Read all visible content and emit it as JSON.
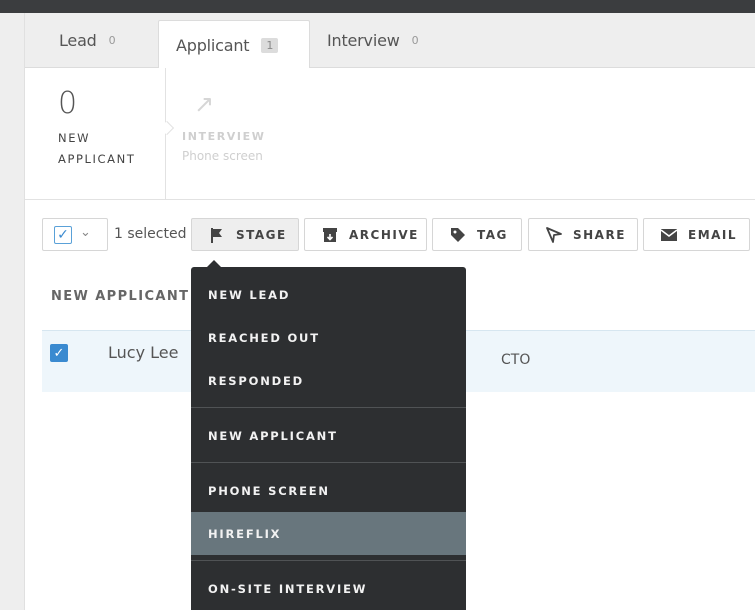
{
  "tabs": [
    {
      "label": "Lead",
      "count": "0"
    },
    {
      "label": "Applicant",
      "count": "1"
    },
    {
      "label": "Interview",
      "count": "0"
    }
  ],
  "stage": {
    "current_count": "0",
    "current_name": "NEW APPLICANT",
    "next_title": "INTERVIEW",
    "next_sub": "Phone screen"
  },
  "toolbar": {
    "selected_text": "1 selected",
    "buttons": [
      "STAGE",
      "ARCHIVE",
      "TAG",
      "SHARE",
      "EMAIL"
    ]
  },
  "list": {
    "header": "NEW APPLICANT",
    "rows": [
      {
        "name": "Lucy Lee",
        "title": "CTO"
      }
    ]
  },
  "stage_menu": {
    "items": [
      "NEW LEAD",
      "REACHED OUT",
      "RESPONDED",
      "NEW APPLICANT",
      "PHONE SCREEN",
      "HIREFLIX",
      "ON-SITE INTERVIEW"
    ],
    "highlighted": "HIREFLIX"
  },
  "colors": {
    "accent": "#3a8ad0",
    "menu_bg": "#2d2f31",
    "menu_highlight": "#68767d",
    "row_selected_bg": "#eef6fb"
  }
}
